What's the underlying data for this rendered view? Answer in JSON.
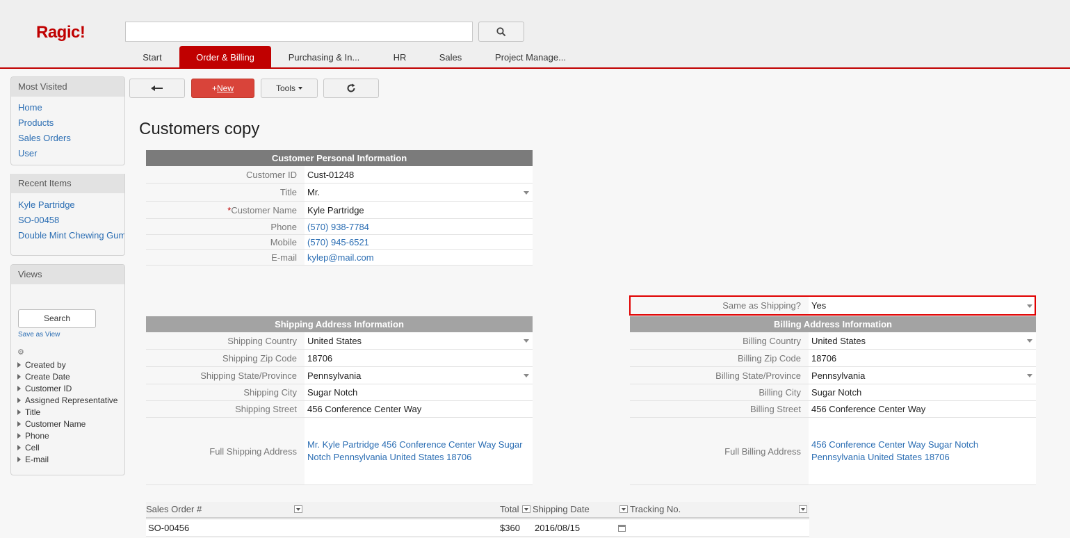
{
  "app": {
    "logo": "Ragic!"
  },
  "search": {
    "placeholder": ""
  },
  "tabs": [
    {
      "label": "Start"
    },
    {
      "label": "Order & Billing",
      "active": true
    },
    {
      "label": "Purchasing & In..."
    },
    {
      "label": "HR"
    },
    {
      "label": "Sales"
    },
    {
      "label": "Project Manage..."
    }
  ],
  "sidebar": {
    "most_visited": {
      "title": "Most Visited",
      "items": [
        "Home",
        "Products",
        "Sales Orders",
        "User"
      ]
    },
    "recent": {
      "title": "Recent Items",
      "items": [
        "Kyle Partridge",
        "SO-00458",
        "Double Mint Chewing Gum"
      ]
    },
    "views": {
      "title": "Views",
      "search_label": "Search",
      "save_view": "Save as View",
      "fields": [
        "Created by",
        "Create Date",
        "Customer ID",
        "Assigned Representative",
        "Title",
        "Customer Name",
        "Phone",
        "Cell",
        "E-mail"
      ]
    }
  },
  "toolbar": {
    "new_plus": "+",
    "new_label": "New",
    "tools_label": "Tools"
  },
  "page": {
    "title": "Customers copy"
  },
  "personal": {
    "heading": "Customer Personal Information",
    "customer_id_label": "Customer ID",
    "customer_id": "Cust-01248",
    "title_label": "Title",
    "title": "Mr.",
    "name_label": "Customer Name",
    "name": "Kyle Partridge",
    "phone_label": "Phone",
    "phone": "(570) 938-7784",
    "mobile_label": "Mobile",
    "mobile": "(570) 945-6521",
    "email_label": "E-mail",
    "email": "kylep@mail.com"
  },
  "same_as_shipping": {
    "label": "Same as Shipping?",
    "value": "Yes"
  },
  "shipping": {
    "heading": "Shipping Address Information",
    "country_label": "Shipping Country",
    "country": "United States",
    "zip_label": "Shipping Zip Code",
    "zip": "18706",
    "state_label": "Shipping State/Province",
    "state": "Pennsylvania",
    "city_label": "Shipping City",
    "city": "Sugar Notch",
    "street_label": "Shipping Street",
    "street": "456 Conference Center Way",
    "full_label": "Full Shipping Address",
    "full": "Mr. Kyle Partridge 456 Conference Center Way Sugar Notch Pennsylvania United States 18706"
  },
  "billing": {
    "heading": "Billing Address Information",
    "country_label": "Billing Country",
    "country": "United States",
    "zip_label": "Billing Zip Code",
    "zip": "18706",
    "state_label": "Billing State/Province",
    "state": "Pennsylvania",
    "city_label": "Billing City",
    "city": "Sugar Notch",
    "street_label": "Billing Street",
    "street": "456 Conference Center Way",
    "full_label": "Full Billing Address",
    "full": "456 Conference Center Way Sugar Notch Pennsylvania United States 18706"
  },
  "orders": {
    "columns": [
      "Sales Order #",
      "Total",
      "Shipping Date",
      "Tracking No."
    ],
    "rows": [
      {
        "order": "SO-00456",
        "total": "$360",
        "date": "2016/08/15",
        "tracking": ""
      }
    ]
  },
  "colors": {
    "brand": "#c00000",
    "link": "#2a6db3",
    "new_button": "#d9443a"
  }
}
